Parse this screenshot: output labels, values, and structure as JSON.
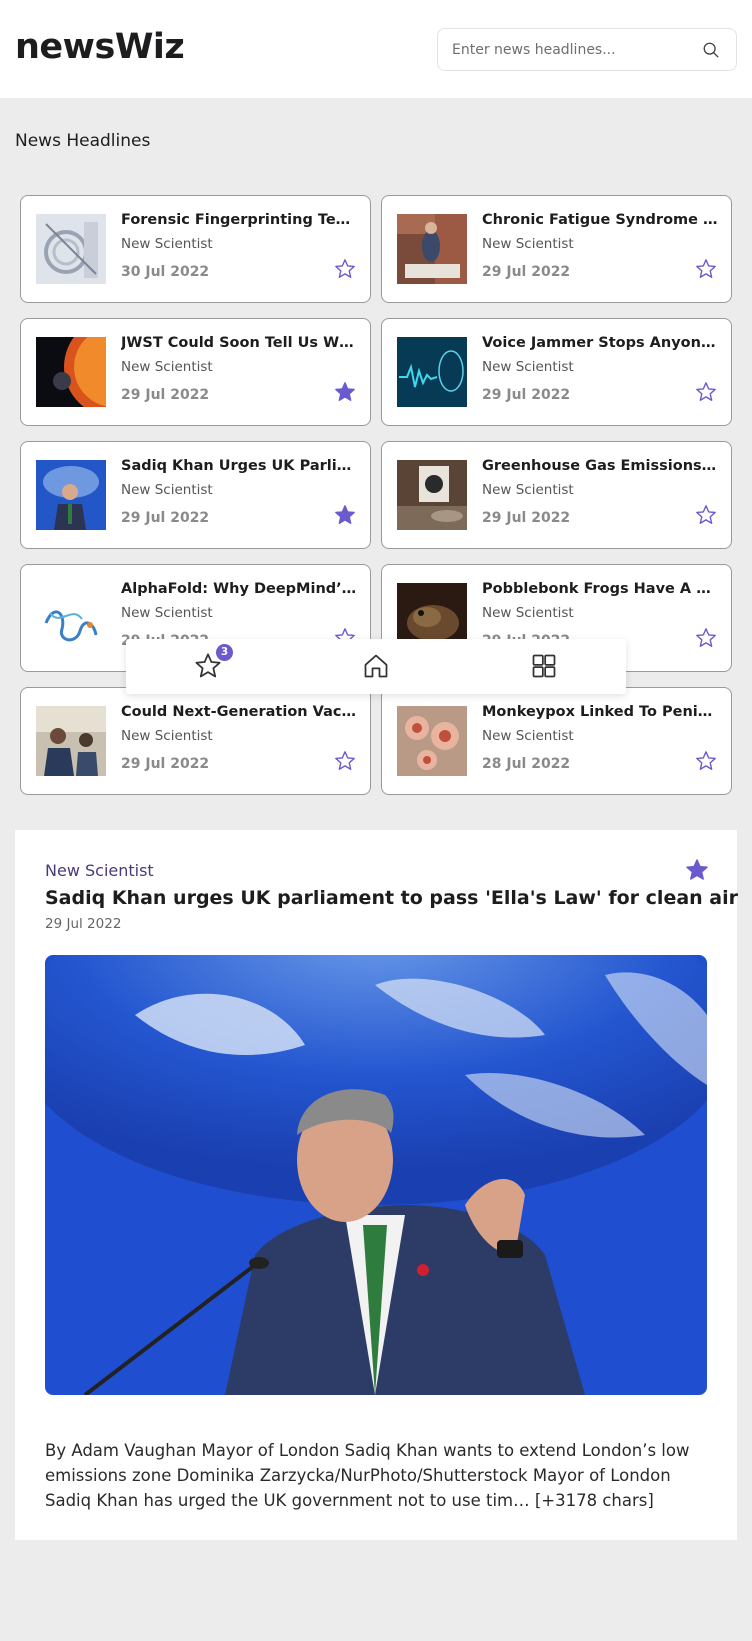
{
  "app": {
    "title": "newsWiz"
  },
  "search": {
    "placeholder": "Enter news headlines...",
    "icon": "search-icon"
  },
  "section": {
    "title": "News Headlines"
  },
  "colors": {
    "accent": "#6a5acd",
    "background": "#ececec",
    "card_border": "#9a9a9a"
  },
  "articles": [
    {
      "title": "Forensic Fingerprinting Techniques...",
      "source": "New Scientist",
      "date": "30 Jul 2022",
      "starred": false
    },
    {
      "title": "Chronic Fatigue Syndrome May...",
      "source": "New Scientist",
      "date": "29 Jul 2022",
      "starred": false
    },
    {
      "title": "JWST Could Soon Tell Us What ...",
      "source": "New Scientist",
      "date": "29 Jul 2022",
      "starred": true
    },
    {
      "title": "Voice Jammer Stops Anyone Fr...",
      "source": "New Scientist",
      "date": "29 Jul 2022",
      "starred": false
    },
    {
      "title": "Sadiq Khan Urges UK Parliame...",
      "source": "New Scientist",
      "date": "29 Jul 2022",
      "starred": true
    },
    {
      "title": "Greenhouse Gas Emissions Are ...",
      "source": "New Scientist",
      "date": "29 Jul 2022",
      "starred": false
    },
    {
      "title": "AlphaFold: Why DeepMind’s Pro...",
      "source": "New Scientist",
      "date": "29 Jul 2022",
      "starred": false
    },
    {
      "title": "Pobblebonk Frogs Have A Weir...",
      "source": "New Scientist",
      "date": "29 Jul 2022",
      "starred": false
    },
    {
      "title": "Could Next-Generation Vaccin...",
      "source": "New Scientist",
      "date": "29 Jul 2022",
      "starred": false
    },
    {
      "title": "Monkeypox Linked To Penis Sw...",
      "source": "New Scientist",
      "date": "28 Jul 2022",
      "starred": false
    }
  ],
  "nav": {
    "favorites_count": "3",
    "items": [
      "star-icon",
      "home-icon",
      "grid-icon"
    ]
  },
  "detail": {
    "source": "New Scientist",
    "title": "Sadiq Khan urges UK parliament to pass 'Ella's Law' for clean air",
    "date": "29 Jul 2022",
    "starred": true,
    "body": "By Adam Vaughan Mayor of London Sadiq Khan wants to extend London’s low emissions zone Dominika Zarzycka/NurPhoto/Shutterstock Mayor of London Sadiq Khan has urged the UK government not to use tim… [+3178 chars]"
  }
}
